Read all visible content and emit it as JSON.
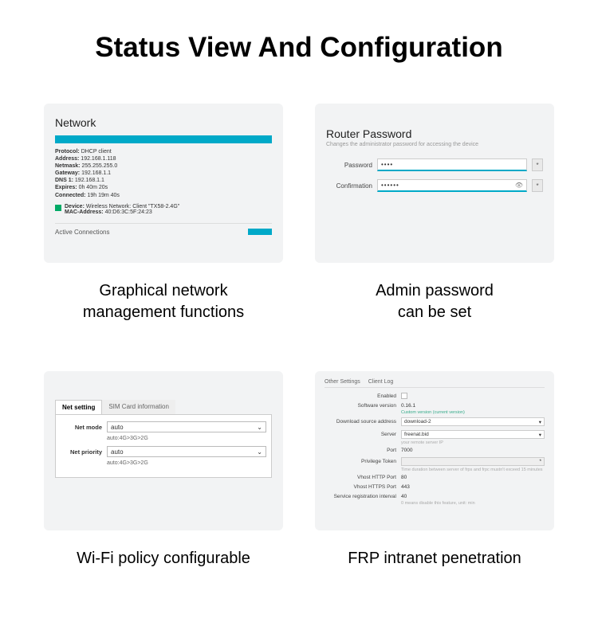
{
  "page_title": "Status View And Configuration",
  "cards": [
    {
      "caption": "Graphical network\nmanagement functions",
      "network": {
        "title": "Network",
        "protocol_label": "Protocol:",
        "protocol": "DHCP client",
        "address_label": "Address:",
        "address": "192.168.1.118",
        "netmask_label": "Netmask:",
        "netmask": "255.255.255.0",
        "gateway_label": "Gateway:",
        "gateway": "192.168.1.1",
        "dns_label": "DNS 1:",
        "dns": "192.168.1.1",
        "expires_label": "Expires:",
        "expires": "0h 40m 20s",
        "connected_label": "Connected:",
        "connected": "19h 19m 40s",
        "device_label": "Device:",
        "device": "Wireless Network: Client \"TX58-2.4G\"",
        "mac_label": "MAC-Address:",
        "mac": "40:D6:3C:5F:24:23",
        "active_connections": "Active Connections"
      }
    },
    {
      "caption": "Admin password\ncan be set",
      "password": {
        "title": "Router Password",
        "subtitle": "Changes the administrator password for accessing the device",
        "password_label": "Password",
        "password_value": "••••",
        "confirm_label": "Confirmation",
        "confirm_value": "••••••",
        "reveal_symbol": "*"
      }
    },
    {
      "caption": "Wi-Fi policy configurable",
      "wifi": {
        "tab1": "Net setting",
        "tab2": "SIM Card information",
        "mode_label": "Net mode",
        "mode_value": "auto",
        "mode_hint": "auto:4G>3G>2G",
        "priority_label": "Net priority",
        "priority_value": "auto",
        "priority_hint": "auto:4G>3G>2G"
      }
    },
    {
      "caption": "FRP intranet penetration",
      "frp": {
        "tab1": "Other Settings",
        "tab2": "Client Log",
        "enabled_label": "Enabled",
        "version_label": "Software version",
        "version": "0.16.1",
        "version_hint": "Custom version (current version)",
        "dl_label": "Download source address",
        "dl": "download-2",
        "server_label": "Server",
        "server": "freenat.bid",
        "server_hint": "your remote server IP",
        "port_label": "Port",
        "port": "7000",
        "token_label": "Privilege Token",
        "token": "",
        "token_hint": "Time duration between server of frps and frpc mustn't exceed 15 minutes",
        "http_label": "Vhost HTTP Port",
        "http": "80",
        "https_label": "Vhost HTTPS Port",
        "https": "443",
        "interval_label": "Service registration interval",
        "interval": "40",
        "interval_hint": "0 means disable this feature, unit: min"
      }
    }
  ]
}
